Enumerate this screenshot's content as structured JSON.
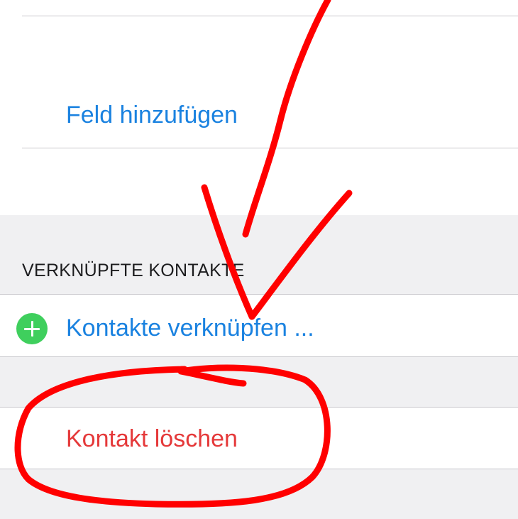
{
  "rows": {
    "add_field_label": "Feld hinzufügen",
    "linked_contacts_header": "VERKNÜPFTE KONTAKTE",
    "link_contacts_label": "Kontakte verknüpfen ...",
    "delete_contact_label": "Kontakt löschen"
  },
  "icons": {
    "add_icon": "plus-circle-icon"
  },
  "colors": {
    "link_blue": "#1a82e0",
    "destructive_red": "#e5393a",
    "add_green": "#3fcf5d",
    "annotation_red": "#ff0000"
  }
}
